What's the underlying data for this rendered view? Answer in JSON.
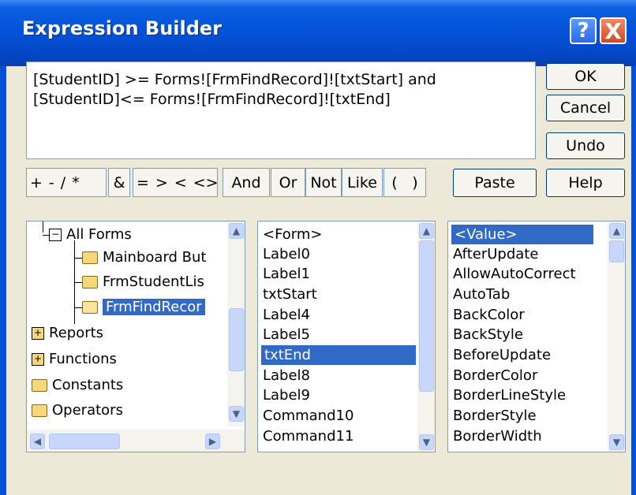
{
  "window": {
    "title": "Expression Builder",
    "help_glyph": "?",
    "close_glyph": "X"
  },
  "expression": {
    "line1": "[StudentID] >= Forms![FrmFindRecord]![txtStart] and",
    "line2": "[StudentID]<= Forms![FrmFindRecord]![txtEnd]"
  },
  "buttons": {
    "ok": "OK",
    "cancel": "Cancel",
    "undo": "Undo",
    "paste": "Paste",
    "help": "Help"
  },
  "operators": {
    "arith": [
      "+",
      "-",
      "/",
      "*"
    ],
    "concat": "&",
    "compare": [
      "=",
      ">",
      "<",
      "<>"
    ],
    "and": "And",
    "or": "Or",
    "not": "Not",
    "like": "Like",
    "paren": [
      "(",
      ")"
    ]
  },
  "tree": {
    "items": [
      {
        "label": "All Forms",
        "type": "expanded"
      },
      {
        "label": "Mainboard But",
        "type": "folder"
      },
      {
        "label": "FrmStudentLis",
        "type": "folder"
      },
      {
        "label": "FrmFindRecor",
        "type": "folder-open",
        "selected": true
      },
      {
        "label": "Reports",
        "type": "collapsed"
      },
      {
        "label": "Functions",
        "type": "collapsed"
      },
      {
        "label": "Constants",
        "type": "folder"
      },
      {
        "label": "Operators",
        "type": "folder"
      }
    ]
  },
  "middle_list": {
    "items": [
      "<Form>",
      "Label0",
      "Label1",
      "txtStart",
      "Label4",
      "Label5",
      "txtEnd",
      "Label8",
      "Label9",
      "Command10",
      "Command11"
    ],
    "selected": "txtEnd"
  },
  "right_list": {
    "items": [
      "<Value>",
      "AfterUpdate",
      "AllowAutoCorrect",
      "AutoTab",
      "BackColor",
      "BackStyle",
      "BeforeUpdate",
      "BorderColor",
      "BorderLineStyle",
      "BorderStyle",
      "BorderWidth"
    ],
    "selected": "<Value>"
  },
  "colors": {
    "selection": "#316ac5",
    "titlebar": "#0451d8",
    "dialog": "#ece9d8"
  }
}
